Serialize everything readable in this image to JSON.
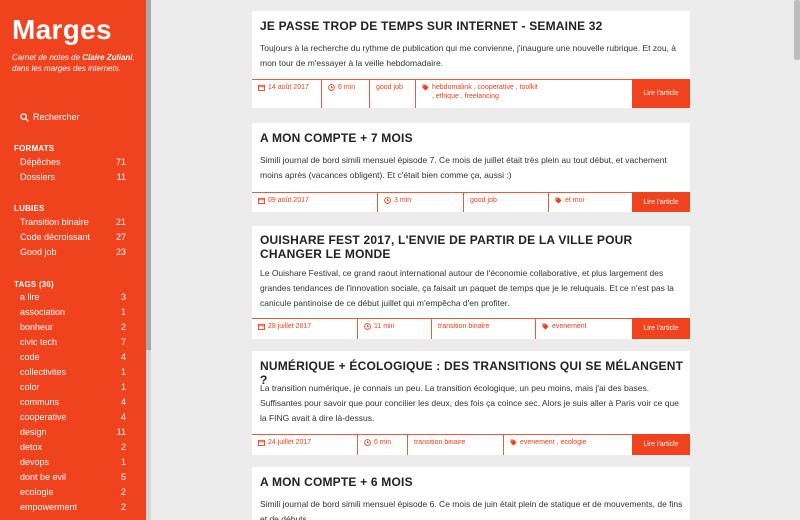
{
  "site": {
    "title": "Marges",
    "tagline_pre": "Carnet de notes de",
    "tagline_author": "Claire Zuliani",
    "tagline_post": ", dans les marges des internets."
  },
  "search": {
    "label": "Rechercher"
  },
  "formats": {
    "title": "FORMATS",
    "items": [
      {
        "label": "Dépêches",
        "count": "71"
      },
      {
        "label": "Dossiers",
        "count": "11"
      }
    ]
  },
  "lubies": {
    "title": "LUBIES",
    "items": [
      {
        "label": "Transition binaire",
        "count": "21"
      },
      {
        "label": "Code décroissant",
        "count": "27"
      },
      {
        "label": "Good job",
        "count": "23"
      }
    ]
  },
  "tags": {
    "title": "TAGS (36)",
    "items": [
      {
        "label": "a lire",
        "count": "3"
      },
      {
        "label": "association",
        "count": "1"
      },
      {
        "label": "bonheur",
        "count": "2"
      },
      {
        "label": "civic tech",
        "count": "7"
      },
      {
        "label": "code",
        "count": "4"
      },
      {
        "label": "collectivites",
        "count": "1"
      },
      {
        "label": "color",
        "count": "1"
      },
      {
        "label": "communs",
        "count": "4"
      },
      {
        "label": "cooperative",
        "count": "4"
      },
      {
        "label": "design",
        "count": "11"
      },
      {
        "label": "detox",
        "count": "2"
      },
      {
        "label": "devops",
        "count": "1"
      },
      {
        "label": "dont be evil",
        "count": "5"
      },
      {
        "label": "ecologie",
        "count": "2"
      },
      {
        "label": "empowerment",
        "count": "2"
      }
    ]
  },
  "posts": [
    {
      "title": "JE PASSE TROP DE TEMPS SUR INTERNET - SEMAINE 32",
      "excerpt": "Toujours à la recherche du rythme de publication qui me convienne, j'inaugure une nouvelle rubrique. Et zou, à mon tour de m'essayer à la veille hebdomadaire.",
      "date": "14 août 2017",
      "duration": "6 min",
      "category": "good job",
      "tags": "hebdomalink , cooperative , toolkit , ethique , freelancing",
      "read": "Lire l'article"
    },
    {
      "title": "A MON COMPTE + 7 MOIS",
      "excerpt": "Simili journal de bord simili mensuel épisode 7. Ce mois de juillet était très plein au tout début, et vachement moins après (vacances obligent). Et c'était bien comme ça, aussi :)",
      "date": "09 août 2017",
      "duration": "3 min",
      "category": "good job",
      "tags": "et moi",
      "read": "Lire l'article"
    },
    {
      "title": "OUISHARE FEST 2017, L'ENVIE DE PARTIR DE LA VILLE POUR CHANGER LE MONDE",
      "excerpt": "Le Ouishare Festival, ce grand raout international autour de l'économie collaborative, et plus largement des grandes tendances de l'innovation sociale, ça faisait un paquet de temps que je le reluquais. Et ce n'est pas la canicule pantinoise de ce début juillet qui m'empêcha d'en profiter.",
      "date": "28 juillet 2017",
      "duration": "11 min",
      "category": "transition binaire",
      "tags": "evenement",
      "read": "Lire l'article"
    },
    {
      "title": "NUMÉRIQUE + ÉCOLOGIQUE : DES TRANSITIONS QUI SE MÉLANGENT ?",
      "excerpt": "La transition numérique, je connais un peu. La transition écologique, un peu moins, mais j'ai des bases. Suffisantes pour savoir que pour concilier les deux, des fois ça coince sec. Alors je suis aller à Paris voir ce que la FING avait à dire là-dessus.",
      "date": "24 juillet 2017",
      "duration": "6 min",
      "category": "transition binaire",
      "tags": "evenement , ecologie",
      "read": "Lire l'article"
    },
    {
      "title": "A MON COMPTE + 6 MOIS",
      "excerpt": "Simili journal de bord simili mensuel épisode 6. Ce mois de juin était plein de statique et de mouvements, de fins et de débuts."
    }
  ],
  "colors": {
    "accent": "#f0421c",
    "background": "#ececec"
  }
}
